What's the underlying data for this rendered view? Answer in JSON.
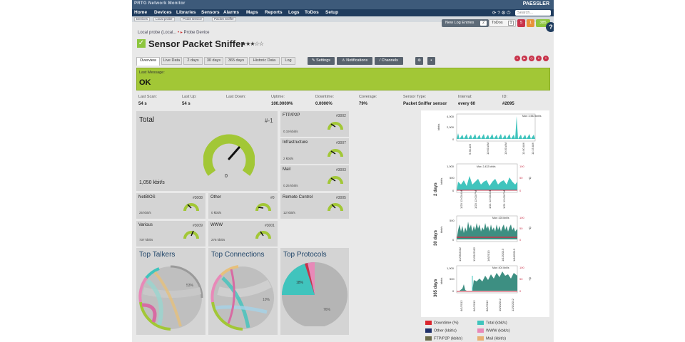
{
  "app": {
    "brand": "PRTG Network Monitor",
    "logo": "PAESSLER",
    "search_placeholder": "Search..."
  },
  "menu": [
    "Home",
    "Devices",
    "Libraries",
    "Sensors",
    "Alarms",
    "Maps",
    "Reports",
    "Logs",
    "ToDos",
    "Setup"
  ],
  "breadcrumbs": [
    "Devices",
    "Local probe",
    "Probe Device",
    "Packet Sniffer"
  ],
  "toolbar": {
    "log_label": "New Log Entries",
    "log_count": "2",
    "todos_label": "ToDos",
    "todos_count": "1",
    "alarm1": "5",
    "alarm2": "1",
    "ok_count": "385"
  },
  "path": {
    "probe": "Local probe (Local...",
    "device": "Probe Device"
  },
  "sensor": {
    "name": "Sensor Packet Sniffer",
    "status": "OK",
    "last_message_label": "Last Message:"
  },
  "tabs": [
    "Overview",
    "Live Data",
    "2 days",
    "30 days",
    "365 days",
    "Historic Data",
    "Log"
  ],
  "actions": [
    "Settings",
    "Notifications",
    "Channels"
  ],
  "stats": [
    {
      "label": "Last Scan:",
      "value": "54 s"
    },
    {
      "label": "Last Up:",
      "value": "54 s"
    },
    {
      "label": "Last Down:",
      "value": ""
    },
    {
      "label": "Uptime:",
      "value": "100.0000%"
    },
    {
      "label": "Downtime:",
      "value": "0.0000%"
    },
    {
      "label": "Coverage:",
      "value": "79%"
    },
    {
      "label": "Sensor Type:",
      "value": "Packet Sniffer sensor"
    },
    {
      "label": "Interval:",
      "value": "every 60"
    },
    {
      "label": "ID:",
      "value": "#2095"
    }
  ],
  "total": {
    "label": "Total",
    "id": "#-1",
    "value": "1,050 kbit/s",
    "gauge_zero": "0"
  },
  "channels": [
    {
      "name": "FTP/P2P",
      "id": "#3002",
      "value": "0.19 kbit/s"
    },
    {
      "name": "Infrastructure",
      "id": "#3007",
      "value": "2 kbit/s"
    },
    {
      "name": "Mail",
      "id": "#3003",
      "value": "0.25 kbit/s"
    },
    {
      "name": "NetBIOS",
      "id": "#3008",
      "value": "25 kbit/s"
    },
    {
      "name": "Other",
      "id": "#0",
      "value": "0 kbit/s"
    },
    {
      "name": "Remote Control",
      "id": "#3005",
      "value": "12 kbit/s"
    },
    {
      "name": "Various",
      "id": "#3009",
      "value": "737 kbit/s"
    },
    {
      "name": "WWW",
      "id": "#3001",
      "value": "275 kbit/s"
    }
  ],
  "toplists": [
    "Top Talkers",
    "Top Connections",
    "Top Protocols"
  ],
  "graphs": [
    {
      "label": "",
      "yticks": [
        "4,000",
        "2,000",
        "0"
      ],
      "xticks": [
        "9:30 AM",
        "10:00 AM",
        "10:30 AM",
        "11:00 AM",
        "11:15 AM"
      ],
      "max": "Max: 3,552 kbit/s",
      "ylabel": "kbit/s"
    },
    {
      "label": "2 days",
      "yticks": [
        "1,000",
        "500",
        "0"
      ],
      "ryticks": [
        "100",
        "50",
        "0"
      ],
      "xticks": [
        "1/20 12:00 AM",
        "1/20 12:00 PM",
        "1/21 12:00 AM",
        "1/21 12:00 PM"
      ],
      "max": "Max: 2,432 kbit/s",
      "ylabel": "kbit/s"
    },
    {
      "label": "30 days",
      "yticks": [
        "500",
        "0"
      ],
      "ryticks": [
        "100",
        "50",
        "0"
      ],
      "xticks": [
        "12/25/2012",
        "12/31/2012",
        "1/6/2013",
        "1/12/2013",
        "1/18/2013"
      ],
      "max": "Max: 428 kbit/s",
      "ylabel": "kbit/s"
    },
    {
      "label": "365 days",
      "yticks": [
        "1,000",
        "500",
        "0"
      ],
      "ryticks": [
        "100",
        "50",
        "0"
      ],
      "xticks": [
        "4/1/2012",
        "6/1/2012",
        "8/1/2012",
        "10/1/2012",
        "12/1/2012"
      ],
      "max": "Max: 404 kbit/s",
      "ylabel": "kbit/s"
    }
  ],
  "legend": [
    {
      "name": "Downtime",
      "unit": "(%)",
      "color": "#d9262e"
    },
    {
      "name": "Total",
      "unit": "(kbit/s)",
      "color": "#40c4bd"
    },
    {
      "name": "Other",
      "unit": "(kbit/s)",
      "color": "#1f3068"
    },
    {
      "name": "WWW",
      "unit": "(kbit/s)",
      "color": "#e889b8"
    },
    {
      "name": "FTP/P2P",
      "unit": "(kbit/s)",
      "color": "#6b6b4a"
    },
    {
      "name": "Mail",
      "unit": "(kbit/s)",
      "color": "#e8b073"
    }
  ],
  "colors": {
    "accent": "#a2c736",
    "nav": "#1f3c5e",
    "alarm": "#c8334a",
    "ok": "#8dc63f"
  }
}
